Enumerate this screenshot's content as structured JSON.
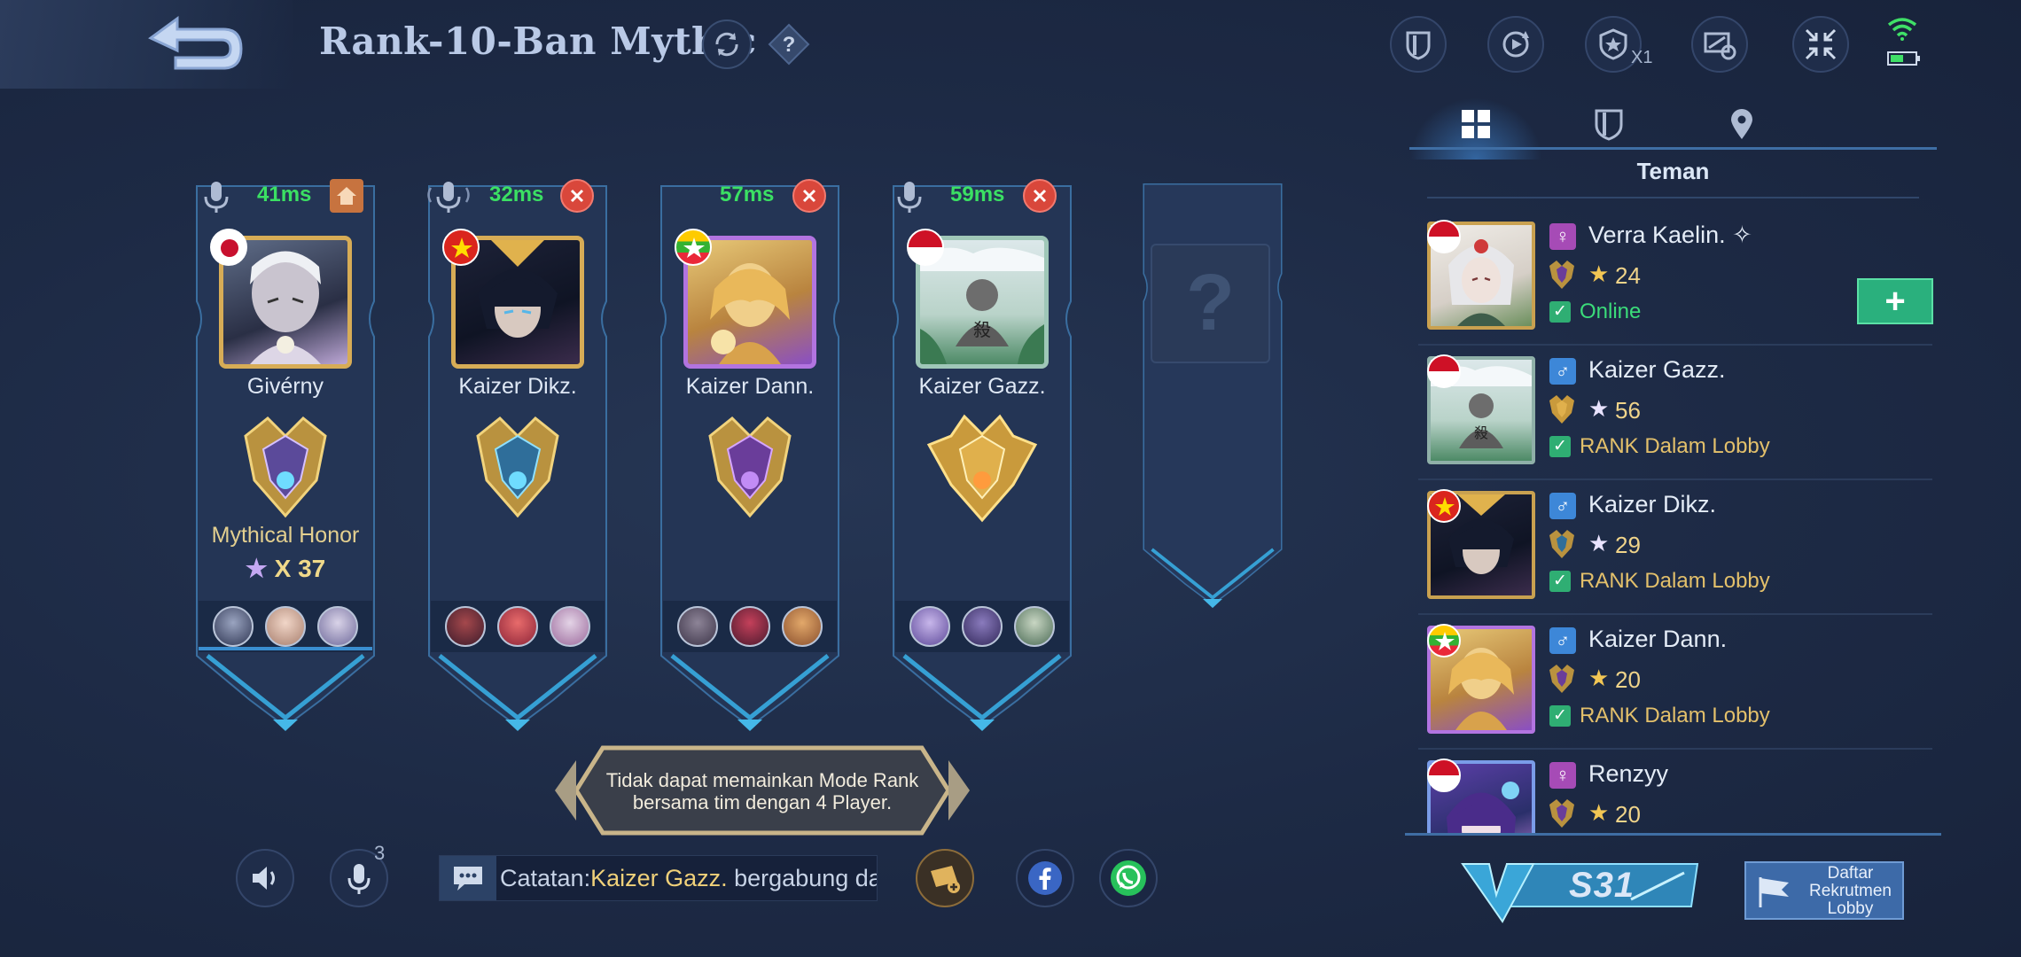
{
  "header": {
    "title": "Rank-10-Ban Mythic",
    "multiplier_label": "X1",
    "icons": [
      "back-arrow-icon",
      "refresh-icon",
      "help-icon",
      "team-shield-icon",
      "replay-icon",
      "shield-star-icon",
      "screen-rotate-icon",
      "collapse-icon",
      "wifi-icon",
      "battery-icon"
    ]
  },
  "slots": [
    {
      "ping": "41ms",
      "name": "Givérny",
      "rank_title": "Mythical Honor",
      "star_prefix": "X",
      "stars": "37",
      "flag": "japan",
      "badge": "home",
      "mic_active": false
    },
    {
      "ping": "32ms",
      "name": "Kaizer Dikz.",
      "flag": "vietnam",
      "badge": "close",
      "mic_active": true
    },
    {
      "ping": "57ms",
      "name": "Kaizer Dann.",
      "flag": "myanmar",
      "badge": "close",
      "mic_active": false
    },
    {
      "ping": "59ms",
      "name": "Kaizer Gazz.",
      "flag": "indonesia",
      "badge": "close",
      "mic_active": false
    },
    {
      "empty_label": "?"
    }
  ],
  "toast": {
    "line1": "Tidak dapat memainkan Mode Rank",
    "line2": "bersama tim dengan 4 Player."
  },
  "bottom_bar": {
    "mic_count": "3",
    "chat_prefix": "Catatan:",
    "chat_name": "Kaizer Gazz.",
    "chat_suffix": " bergabung da"
  },
  "panel": {
    "tabs": [
      "grid-icon",
      "shield-icon",
      "location-pin-icon"
    ],
    "section_title": "Teman",
    "add_label": "+",
    "friends": [
      {
        "name": "Verra Kaelin. ✧",
        "gender": "♀",
        "stars": "24",
        "status": "Online",
        "status_kind": "online",
        "flag": "indonesia"
      },
      {
        "name": "Kaizer Gazz.",
        "gender": "♂",
        "stars": "56",
        "status": "RANK Dalam Lobby",
        "status_kind": "lobby",
        "flag": "indonesia"
      },
      {
        "name": "Kaizer Dikz.",
        "gender": "♂",
        "stars": "29",
        "status": "RANK Dalam Lobby",
        "status_kind": "lobby",
        "flag": "vietnam"
      },
      {
        "name": "Kaizer Dann.",
        "gender": "♂",
        "stars": "20",
        "status": "RANK Dalam Lobby",
        "status_kind": "lobby",
        "flag": "myanmar"
      },
      {
        "name": "Renzyy",
        "gender": "♀",
        "stars": "20",
        "status": "",
        "status_kind": "none",
        "flag": "indonesia"
      }
    ]
  },
  "season": {
    "label": "S31"
  },
  "recruit": {
    "label": "Daftar Rekrutmen Lobby"
  },
  "colors": {
    "background": "#1d2a45",
    "ping_green": "#3be063",
    "gold": "#d7ac56",
    "accent_blue": "#3f6ea4",
    "online_green": "#3bdc7a",
    "lobby_gold": "#e3c06b",
    "close_red": "#d9473b"
  }
}
